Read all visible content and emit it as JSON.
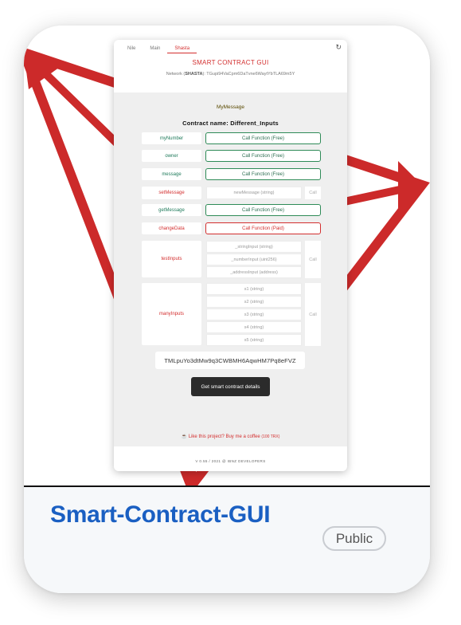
{
  "app": {
    "nav_tabs": [
      {
        "label": "Nile"
      },
      {
        "label": "Main"
      },
      {
        "label": "Shasta"
      }
    ],
    "title": "SMART CONTRACT GUI",
    "network_prefix": "Network (",
    "network_name": "SHASTA",
    "network_suffix": "): TGupi94VaCpm6DaTvne6WaytYbTLA69m5Y",
    "contract_message": "MyMessage",
    "contract_name_label": "Contract name:",
    "contract_name_value": "Different_Inputs",
    "functions": [
      {
        "name": "myNumber",
        "type": "read",
        "button": "Call Function (Free)"
      },
      {
        "name": "owner",
        "type": "read",
        "button": "Call Function (Free)"
      },
      {
        "name": "message",
        "type": "read",
        "button": "Call Function (Free)"
      },
      {
        "name": "setMessage",
        "type": "write",
        "inputs": [
          "newMessage (string)"
        ],
        "button": "Call"
      },
      {
        "name": "getMessage",
        "type": "read",
        "button": "Call Function (Free)"
      },
      {
        "name": "changeData",
        "type": "write",
        "button": "Call Function (Paid)"
      },
      {
        "name": "testInputs",
        "type": "write",
        "inputs": [
          "_stringInput (string)",
          "_numberInput (uint256)",
          "_addressInput (address)"
        ],
        "button": "Call"
      },
      {
        "name": "manyInputs",
        "type": "write",
        "inputs": [
          "s1 (string)",
          "s2 (string)",
          "s3 (string)",
          "s4 (string)",
          "s5 (string)"
        ],
        "button": "Call"
      }
    ],
    "contract_address": "TMLpuYo3dtMw9q3CWBMH6AqwHM7Pq8eFVZ",
    "details_button": "Get smart contract details",
    "coffee_text": "Like this project? Buy me a coffee",
    "coffee_tag": "(100 TRX)",
    "footer": "V 0.55 / 2021 @ IBNZ DEVELOPERS"
  },
  "repo": {
    "name": "Smart-Contract-GUI",
    "visibility": "Public"
  },
  "colors": {
    "accent_red": "#d32f2f",
    "read_green": "#2e8b57",
    "link_blue": "#1a5fc2"
  }
}
